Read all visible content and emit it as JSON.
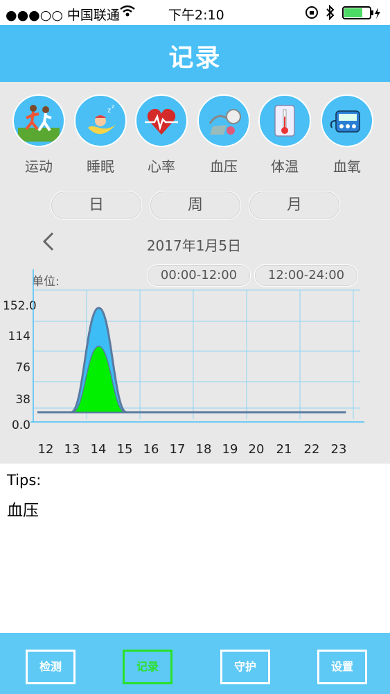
{
  "status_bar": {
    "carrier": "●●●○○ 中国联通",
    "wifi_icon": "wifi-icon",
    "time": "下午2:10",
    "battery_icon": "battery-icon"
  },
  "header": {
    "title": "记录"
  },
  "categories": [
    {
      "label": "运动",
      "icon": "running-icon"
    },
    {
      "label": "睡眠",
      "icon": "sleep-icon"
    },
    {
      "label": "心率",
      "icon": "heart-icon"
    },
    {
      "label": "血压",
      "icon": "blood-pressure-icon"
    },
    {
      "label": "体温",
      "icon": "thermometer-icon"
    },
    {
      "label": "血氧",
      "icon": "oximeter-icon"
    }
  ],
  "period_tabs": [
    "日",
    "周",
    "月"
  ],
  "date_nav": {
    "date": "2017年1月5日",
    "prev_icon": "chevron-left-icon"
  },
  "chart_header": {
    "unit_label": "单位:",
    "ranges": [
      "00:00-12:00",
      "12:00-24:00"
    ]
  },
  "chart_data": {
    "type": "area",
    "x_ticks": [
      "12",
      "13",
      "14",
      "15",
      "16",
      "17",
      "18",
      "19",
      "20",
      "21",
      "22",
      "23"
    ],
    "y_ticks": [
      "152.0",
      "114",
      "76",
      "38",
      "0.0"
    ],
    "ylim": [
      0,
      152
    ],
    "series": [
      {
        "values": [
          0,
          0,
          136,
          0,
          0,
          0,
          0,
          0,
          0,
          0,
          0,
          0
        ],
        "color": "#3dbdf5"
      },
      {
        "values": [
          0,
          0,
          86,
          0,
          0,
          0,
          0,
          0,
          0,
          0,
          0,
          0
        ],
        "color": "#00f000"
      }
    ]
  },
  "tips": {
    "title": "Tips:",
    "body": "血压"
  },
  "tabbar": {
    "tabs": [
      {
        "label": "检测",
        "active": false
      },
      {
        "label": "记录",
        "active": true
      },
      {
        "label": "守护",
        "active": false
      },
      {
        "label": "设置",
        "active": false
      }
    ]
  }
}
